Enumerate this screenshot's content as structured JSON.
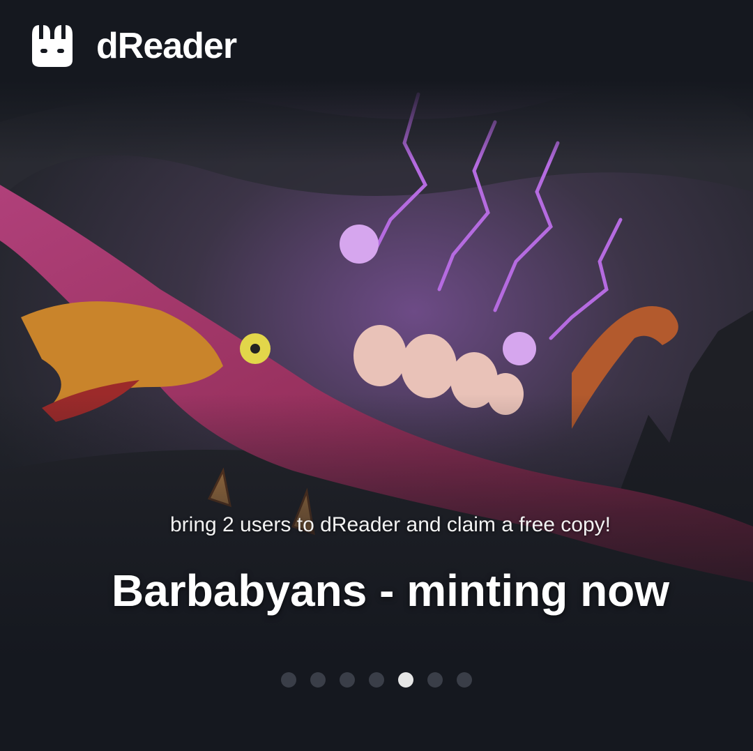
{
  "brand": {
    "name": "dReader",
    "logo_icon": "dreader-bunny-logo"
  },
  "banner": {
    "subtitle": "bring 2 users to dReader and claim a free copy!",
    "title": "Barbabyans - minting now",
    "image": "barbabyans-dragon-artwork"
  },
  "carousel": {
    "slide_count": 7,
    "active_index": 4
  },
  "colors": {
    "background": "#15181f",
    "dot_inactive": "#3a3e48",
    "dot_active": "#e6e6e6",
    "accent_purple": "#b56be0"
  }
}
